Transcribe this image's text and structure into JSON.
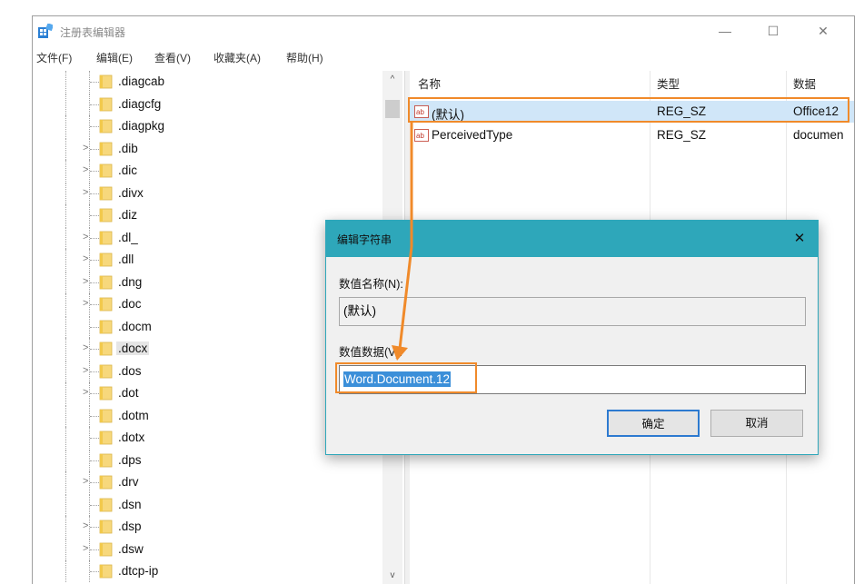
{
  "window": {
    "title": "注册表编辑器",
    "minimize": "—",
    "maximize": "☐",
    "close": "✕"
  },
  "menu": [
    "文件(F)",
    "编辑(E)",
    "查看(V)",
    "收藏夹(A)",
    "帮助(H)"
  ],
  "tree": {
    "items": [
      {
        "label": ".diagcab",
        "expandable": false,
        "selected": false
      },
      {
        "label": ".diagcfg",
        "expandable": false,
        "selected": false
      },
      {
        "label": ".diagpkg",
        "expandable": false,
        "selected": false
      },
      {
        "label": ".dib",
        "expandable": true,
        "selected": false
      },
      {
        "label": ".dic",
        "expandable": true,
        "selected": false
      },
      {
        "label": ".divx",
        "expandable": true,
        "selected": false
      },
      {
        "label": ".diz",
        "expandable": false,
        "selected": false
      },
      {
        "label": ".dl_",
        "expandable": true,
        "selected": false
      },
      {
        "label": ".dll",
        "expandable": true,
        "selected": false
      },
      {
        "label": ".dng",
        "expandable": true,
        "selected": false
      },
      {
        "label": ".doc",
        "expandable": true,
        "selected": false
      },
      {
        "label": ".docm",
        "expandable": false,
        "selected": false
      },
      {
        "label": ".docx",
        "expandable": true,
        "selected": true
      },
      {
        "label": ".dos",
        "expandable": true,
        "selected": false
      },
      {
        "label": ".dot",
        "expandable": true,
        "selected": false
      },
      {
        "label": ".dotm",
        "expandable": false,
        "selected": false
      },
      {
        "label": ".dotx",
        "expandable": false,
        "selected": false
      },
      {
        "label": ".dps",
        "expandable": false,
        "selected": false
      },
      {
        "label": ".drv",
        "expandable": true,
        "selected": false
      },
      {
        "label": ".dsn",
        "expandable": false,
        "selected": false
      },
      {
        "label": ".dsp",
        "expandable": true,
        "selected": false
      },
      {
        "label": ".dsw",
        "expandable": true,
        "selected": false
      },
      {
        "label": ".dtcp-ip",
        "expandable": false,
        "selected": false
      }
    ],
    "scroll_up": "^",
    "scroll_down": "v"
  },
  "list": {
    "columns": [
      "名称",
      "类型",
      "数据"
    ],
    "rows": [
      {
        "name": "(默认)",
        "type": "REG_SZ",
        "data": "Office12",
        "selected": true
      },
      {
        "name": "PerceivedType",
        "type": "REG_SZ",
        "data": "documen",
        "selected": false
      }
    ],
    "icon_text": "ab"
  },
  "dialog": {
    "title": "编辑字符串",
    "close": "✕",
    "name_label": "数值名称(N):",
    "name_value": "(默认)",
    "data_label": "数值数据(V):",
    "data_value": "Word.Document.12",
    "ok": "确定",
    "cancel": "取消"
  },
  "colors": {
    "accent": "#2ea7ba",
    "annotation": "#f08a2a",
    "selection": "#3b8fd9",
    "folder": "#f7d87c"
  }
}
